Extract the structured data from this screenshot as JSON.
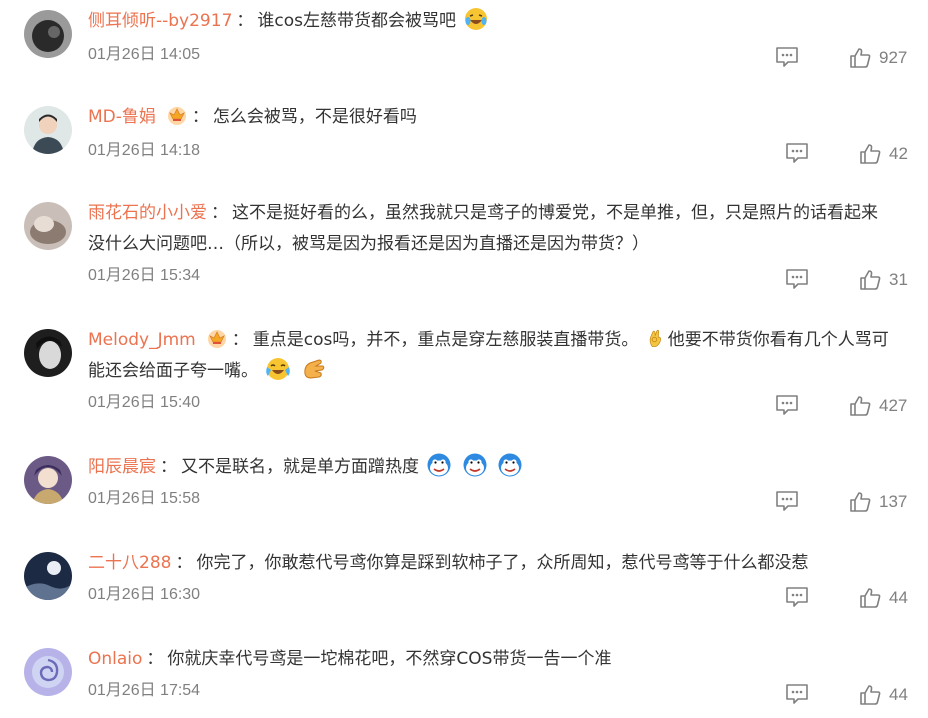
{
  "comments": [
    {
      "username": "侧耳倾听--by2917",
      "text": "谁cos左慈带货都会被骂吧",
      "time": "01月26日 14:05",
      "likes": "927",
      "vip": false,
      "avatar_icon": "avatar-dark-photo",
      "trailing_emojis": [
        "laughing-crying-emoji"
      ]
    },
    {
      "username": "MD-鲁娟",
      "text": "怎么会被骂，不是很好看吗",
      "time": "01月26日 14:18",
      "likes": "42",
      "vip": true,
      "avatar_icon": "avatar-person-photo"
    },
    {
      "username": "雨花石的小小爱",
      "text_line1": "这不是挺好看的么，虽然我就只是鸢子的博爱党，不是单推，但，只是照片的话看起来",
      "text_line2": "没什么大问题吧…（所以，被骂是因为报看还是因为直播还是因为带货？）",
      "time": "01月26日 15:34",
      "likes": "31",
      "vip": false,
      "avatar_icon": "avatar-cat-photo"
    },
    {
      "username": "Melody_Jmm",
      "text_line1a": "重点是cos吗，并不，重点是穿左慈服装直播带货。",
      "text_line1b": "他要不带货你看有几个人骂可",
      "text_line2": "能还会给面子夸一嘴。",
      "time": "01月26日 15:40",
      "likes": "427",
      "vip": true,
      "avatar_icon": "avatar-bw-portrait",
      "emojis": [
        "ok-hand-emoji",
        "laugh-tears-emoji",
        "clap-hand-emoji"
      ]
    },
    {
      "username": "阳辰晨宸",
      "text": "又不是联名，就是单方面蹭热度",
      "time": "01月26日 15:58",
      "likes": "137",
      "vip": false,
      "avatar_icon": "avatar-anime-art",
      "trailing_emojis": [
        "doge-emoji",
        "doge-emoji",
        "doge-emoji"
      ]
    },
    {
      "username": "二十八288",
      "text": "你完了，你敢惹代号鸢你算是踩到软柿子了，众所周知，惹代号鸢等于什么都没惹",
      "time": "01月26日 16:30",
      "likes": "44",
      "vip": false,
      "avatar_icon": "avatar-night-sky"
    },
    {
      "username": "Onlaio",
      "text": "你就庆幸代号鸢是一坨棉花吧，不然穿COS带货一告一个准",
      "time": "01月26日 17:54",
      "likes": "44",
      "vip": false,
      "avatar_icon": "avatar-swirl-icon"
    }
  ],
  "colors": {
    "username": "#eb7350",
    "text": "#333333",
    "meta": "#808080"
  }
}
